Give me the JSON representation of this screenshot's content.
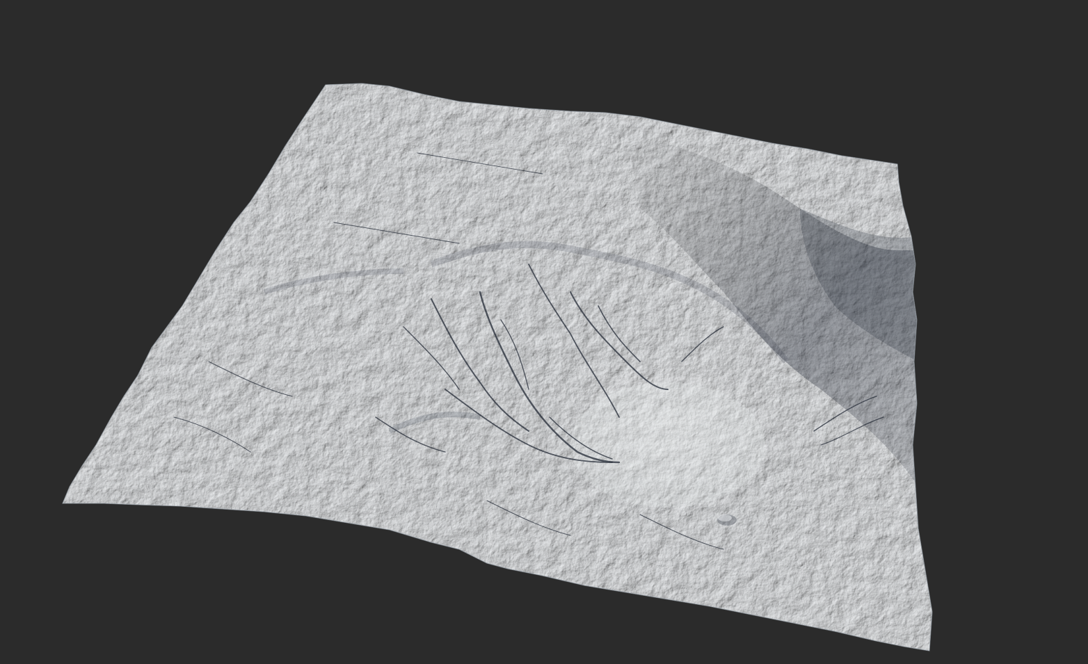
{
  "scene": {
    "background_color": "#2b2b2b",
    "subject": "terrain-heightmap-render",
    "surface_color": "#c9ced4",
    "shadow_color": "#2d323b",
    "highlight_color": "#eef0f2"
  }
}
